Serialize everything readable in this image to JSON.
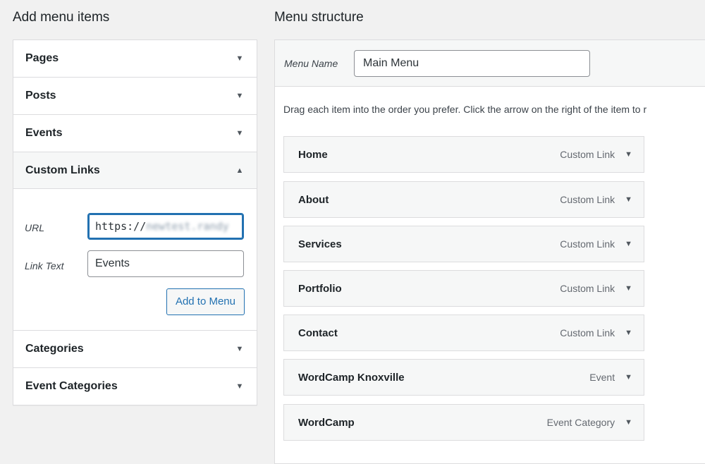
{
  "left": {
    "title": "Add menu items",
    "sections": [
      {
        "label": "Pages"
      },
      {
        "label": "Posts"
      },
      {
        "label": "Events"
      },
      {
        "label": "Custom Links"
      },
      {
        "label": "Categories"
      },
      {
        "label": "Event Categories"
      }
    ],
    "custom_links": {
      "url_label": "URL",
      "url_value_visible": "https://",
      "url_value_blurred": "newtest.randy",
      "link_text_label": "Link Text",
      "link_text_value": "Events",
      "add_button": "Add to Menu"
    },
    "arrows": {
      "collapsed": "▼",
      "expanded": "▲"
    }
  },
  "right": {
    "title": "Menu structure",
    "menu_name_label": "Menu Name",
    "menu_name_value": "Main Menu",
    "instructions": "Drag each item into the order you prefer. Click the arrow on the right of the item to r",
    "items": [
      {
        "title": "Home",
        "type": "Custom Link"
      },
      {
        "title": "About",
        "type": "Custom Link"
      },
      {
        "title": "Services",
        "type": "Custom Link"
      },
      {
        "title": "Portfolio",
        "type": "Custom Link"
      },
      {
        "title": "Contact",
        "type": "Custom Link"
      },
      {
        "title": "WordCamp Knoxville",
        "type": "Event"
      },
      {
        "title": "WordCamp",
        "type": "Event Category"
      }
    ],
    "item_arrow": "▼"
  },
  "colors": {
    "background": "#f1f1f1",
    "accent": "#2271b1",
    "border": "#dcdcde"
  }
}
